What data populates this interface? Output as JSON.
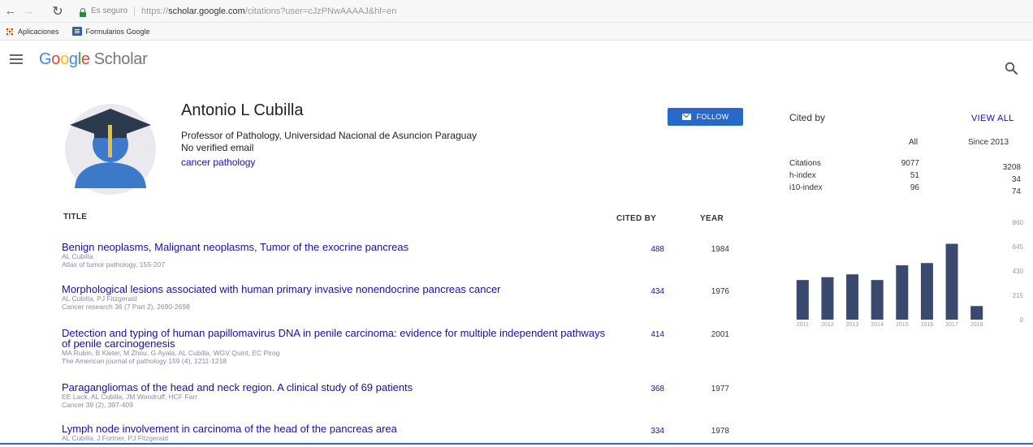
{
  "browser": {
    "secure_label": "Es seguro",
    "url_scheme": "https://",
    "url_domain": "scholar.google.com",
    "url_path": "/citations?user=cJzPNwAAAAJ&hl=en"
  },
  "bookmarks": {
    "apps_label": "Aplicaciones",
    "forms_label": "Formularios Google"
  },
  "header": {
    "logo_text": "Google",
    "product": "Scholar"
  },
  "profile": {
    "name": "Antonio L Cubilla",
    "affiliation": "Professor of Pathology, Universidad Nacional de Asuncion Paraguay",
    "email_status": "No verified email",
    "interest": "cancer pathology",
    "follow_label": "FOLLOW"
  },
  "articles_header": {
    "title": "TITLE",
    "cited_by": "CITED BY",
    "year": "YEAR"
  },
  "articles": [
    {
      "title": "Benign neoplasms, Malignant neoplasms, Tumor of the exocrine pancreas",
      "authors": "AL Cubilla",
      "venue": "Atlas of tumor pathology, 155-207",
      "cited_by": "488",
      "year": "1984"
    },
    {
      "title": "Morphological lesions associated with human primary invasive nonendocrine pancreas cancer",
      "authors": "AL Cubilla, PJ Fitzgerald",
      "venue": "Cancer research 36 (7 Part 2), 2690-2698",
      "cited_by": "434",
      "year": "1976"
    },
    {
      "title": "Detection and typing of human papillomavirus DNA in penile carcinoma: evidence for multiple independent pathways of penile carcinogenesis",
      "authors": "MA Rubin, B Kleter, M Zhou, G Ayala, AL Cubilla, WGV Quint, EC Pirog",
      "venue": "The American journal of pathology 159 (4), 1211-1218",
      "cited_by": "414",
      "year": "2001"
    },
    {
      "title": "Paragangliomas of the head and neck region. A clinical study of 69 patients",
      "authors": "EE Lack, AL Cubilla, JM Woodruff, HCF Farr",
      "venue": "Cancer 39 (2), 397-409",
      "cited_by": "368",
      "year": "1977"
    },
    {
      "title": "Lymph node involvement in carcinoma of the head of the pancreas area",
      "authors": "AL Cubilla, J Fortner, PJ Fitzgerald",
      "venue": "",
      "cited_by": "334",
      "year": "1978"
    }
  ],
  "cited_by": {
    "title": "Cited by",
    "view_all": "VIEW ALL",
    "col_all": "All",
    "col_since": "Since 2013",
    "rows": [
      {
        "label": "Citations",
        "all": "9077",
        "since": "3208"
      },
      {
        "label": "h-index",
        "all": "51",
        "since": "34"
      },
      {
        "label": "i10-index",
        "all": "96",
        "since": "74"
      }
    ]
  },
  "chart_data": {
    "type": "bar",
    "categories": [
      "2011",
      "2012",
      "2013",
      "2014",
      "2015",
      "2016",
      "2017",
      "2018"
    ],
    "values": [
      350,
      375,
      400,
      350,
      480,
      500,
      670,
      120
    ],
    "y_ticks": [
      0,
      215,
      430,
      645,
      860
    ],
    "ylim": [
      0,
      860
    ],
    "colors": {
      "bar": "#3a4a6e",
      "tick": "#999999"
    }
  }
}
